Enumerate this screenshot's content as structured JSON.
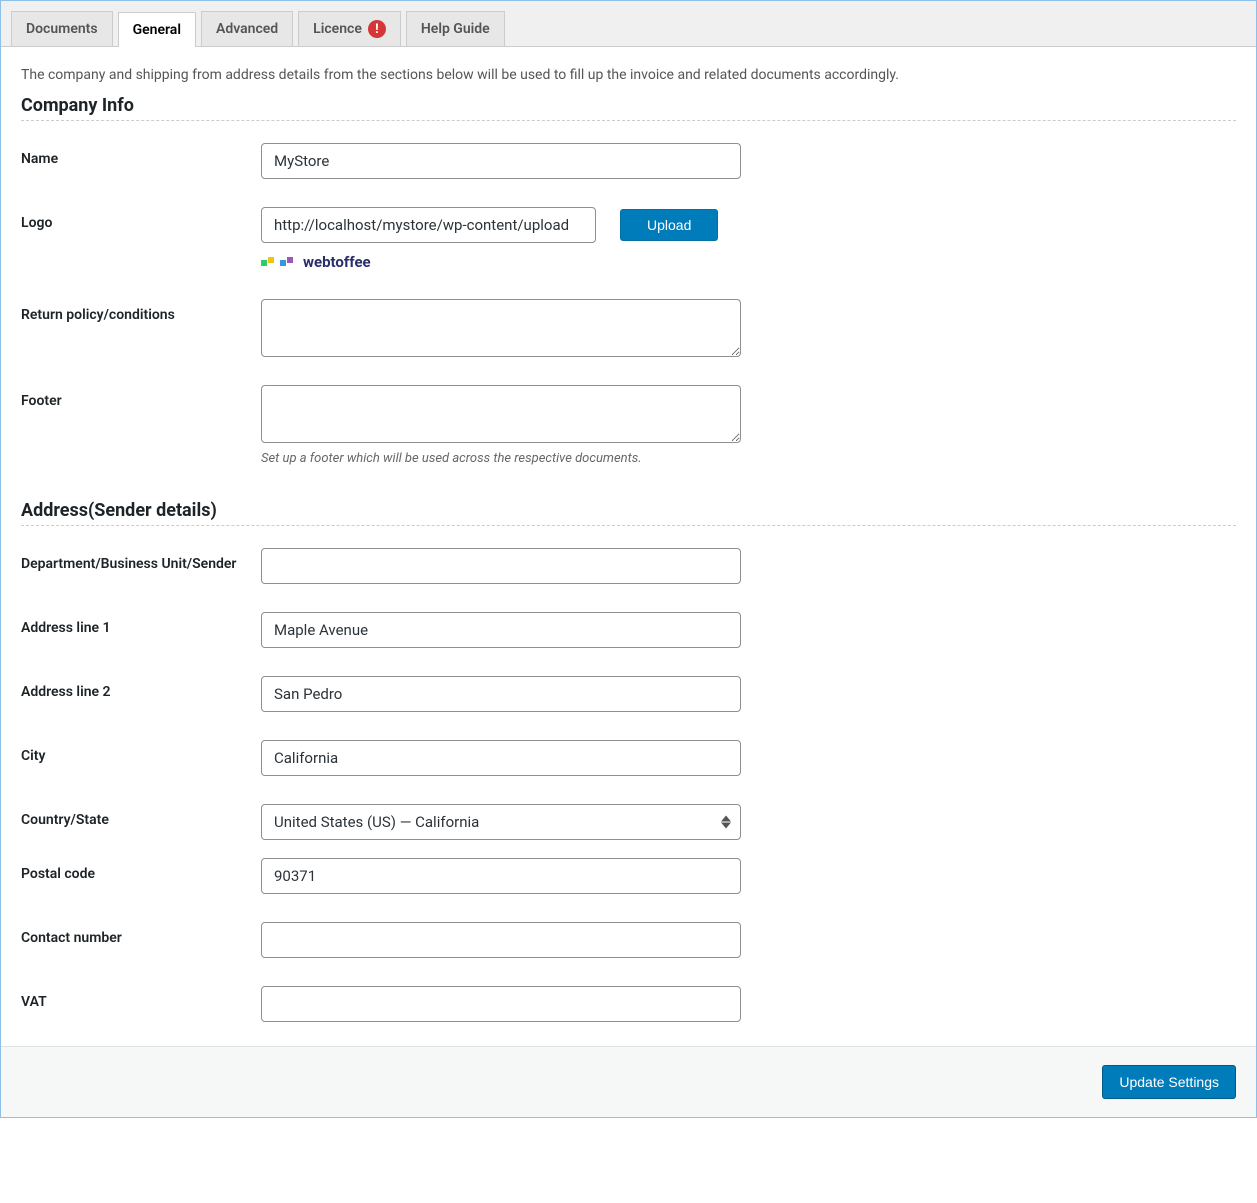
{
  "tabs": {
    "documents": "Documents",
    "general": "General",
    "advanced": "Advanced",
    "licence": "Licence",
    "licence_badge": "!",
    "help": "Help Guide"
  },
  "intro": "The company and shipping from address details from the sections below will be used to fill up the invoice and related documents accordingly.",
  "sections": {
    "company": "Company Info",
    "address": "Address(Sender details)"
  },
  "company": {
    "name_label": "Name",
    "name_value": "MyStore",
    "logo_label": "Logo",
    "logo_value": "http://localhost/mystore/wp-content/upload",
    "upload_btn": "Upload",
    "logo_brand": "webtoffee",
    "return_label": "Return policy/conditions",
    "return_value": "",
    "footer_label": "Footer",
    "footer_value": "",
    "footer_help": "Set up a footer which will be used across the respective documents."
  },
  "addr": {
    "dept_label": "Department/Business Unit/Sender",
    "dept_value": "",
    "line1_label": "Address line 1",
    "line1_value": "Maple Avenue",
    "line2_label": "Address line 2",
    "line2_value": "San Pedro",
    "city_label": "City",
    "city_value": "California",
    "country_label": "Country/State",
    "country_value": "United States (US) — California",
    "postal_label": "Postal code",
    "postal_value": "90371",
    "contact_label": "Contact number",
    "contact_value": "",
    "vat_label": "VAT",
    "vat_value": ""
  },
  "actions": {
    "update": "Update Settings"
  }
}
